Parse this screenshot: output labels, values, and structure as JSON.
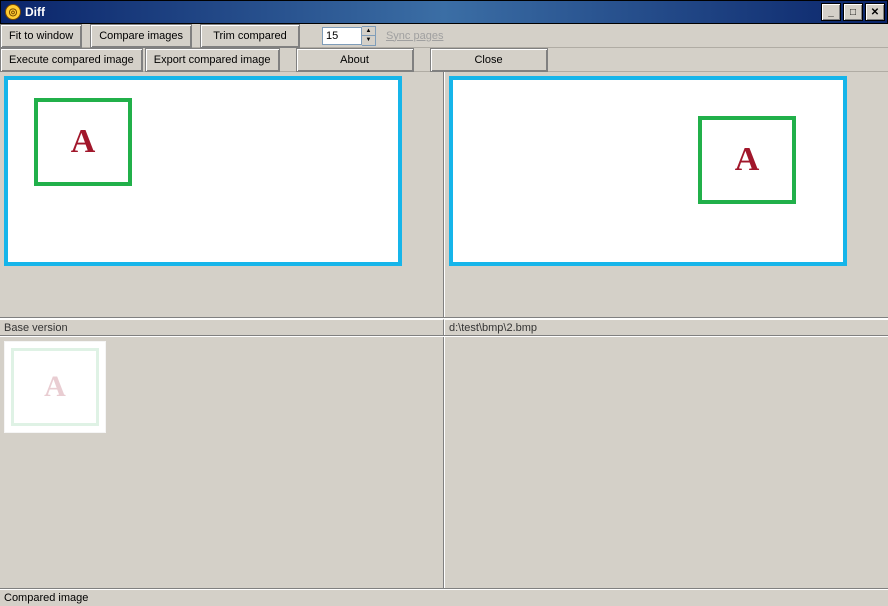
{
  "window": {
    "title": "Diff"
  },
  "toolbar1": {
    "fit": "Fit to window",
    "compare": "Compare images",
    "trim": "Trim compared",
    "spin_value": "15",
    "sync": "Sync pages"
  },
  "toolbar2": {
    "execute": "Execute compared image",
    "export": "Export compared image",
    "about": "About",
    "close": "Close"
  },
  "panes": {
    "left_label": "Base version",
    "right_label": "d:\\test\\bmp\\2.bmp",
    "glyph": "A"
  },
  "footer": {
    "label": "Compared image"
  }
}
